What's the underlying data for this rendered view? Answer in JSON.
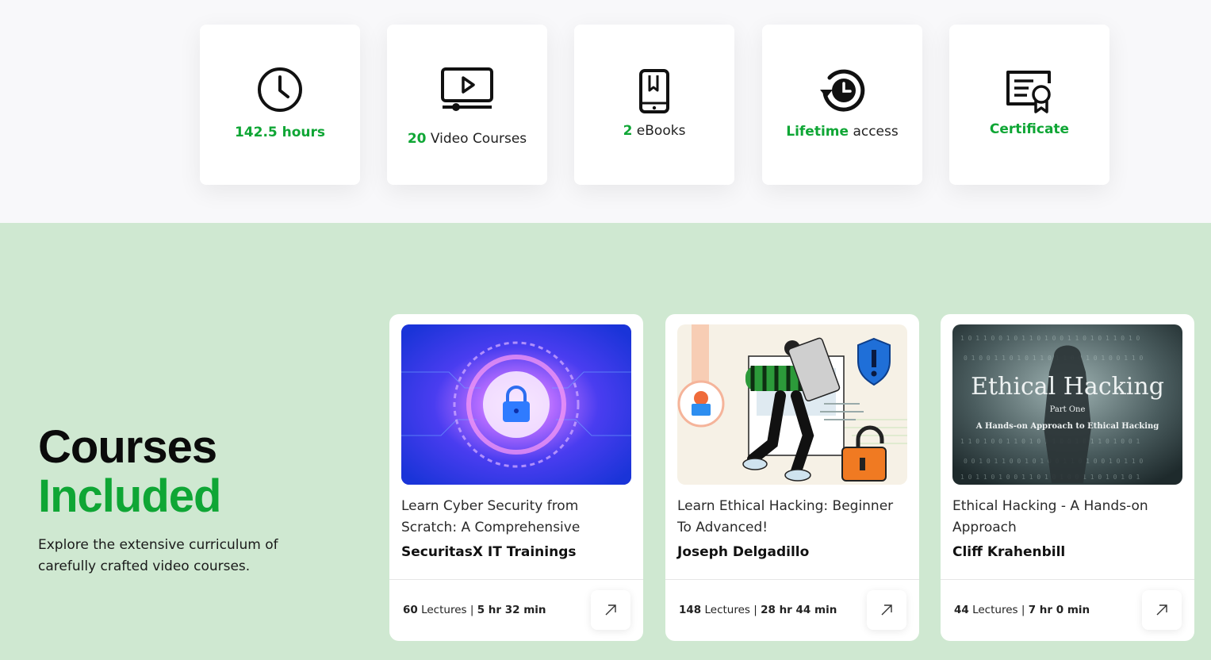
{
  "features": [
    {
      "highlight": "142.5 hours",
      "rest": "",
      "icon": "clock-icon"
    },
    {
      "highlight": "20",
      "rest": " Video Courses",
      "icon": "video-player-icon"
    },
    {
      "highlight": "2",
      "rest": " eBooks",
      "icon": "tablet-icon"
    },
    {
      "highlight": "Lifetime",
      "rest": " access",
      "icon": "lifetime-clock-icon"
    },
    {
      "highlight": "Certificate",
      "rest": "",
      "icon": "certificate-icon"
    }
  ],
  "section": {
    "heading_line1": "Courses",
    "heading_line2": "Included",
    "description": "Explore the extensive curriculum of carefully crafted video courses."
  },
  "courses": [
    {
      "title": "Learn Cyber Security from Scratch: A Comprehensive",
      "author": "SecuritasX IT Trainings",
      "lectures": "60",
      "lectures_label": " Lectures | ",
      "duration": "5 hr 32 min",
      "image": "cyber-lock-image"
    },
    {
      "title": "Learn Ethical Hacking: Beginner To Advanced!",
      "author": "Joseph Delgadillo",
      "lectures": "148",
      "lectures_label": " Lectures | ",
      "duration": "28 hr 44 min",
      "image": "hacker-illustration-image"
    },
    {
      "title": "Ethical Hacking - A Hands-on Approach",
      "author": "Cliff Krahenbill",
      "lectures": "44",
      "lectures_label": " Lectures | ",
      "duration": "7 hr 0 min",
      "image": "ethical-hacking-cover-image",
      "thumb_text": {
        "line1": "Ethical Hacking",
        "line2": "Part One",
        "line3": "A Hands-on Approach to Ethical Hacking"
      }
    }
  ],
  "colors": {
    "accent": "#0fa635",
    "section_bg": "#cfe8d1"
  }
}
